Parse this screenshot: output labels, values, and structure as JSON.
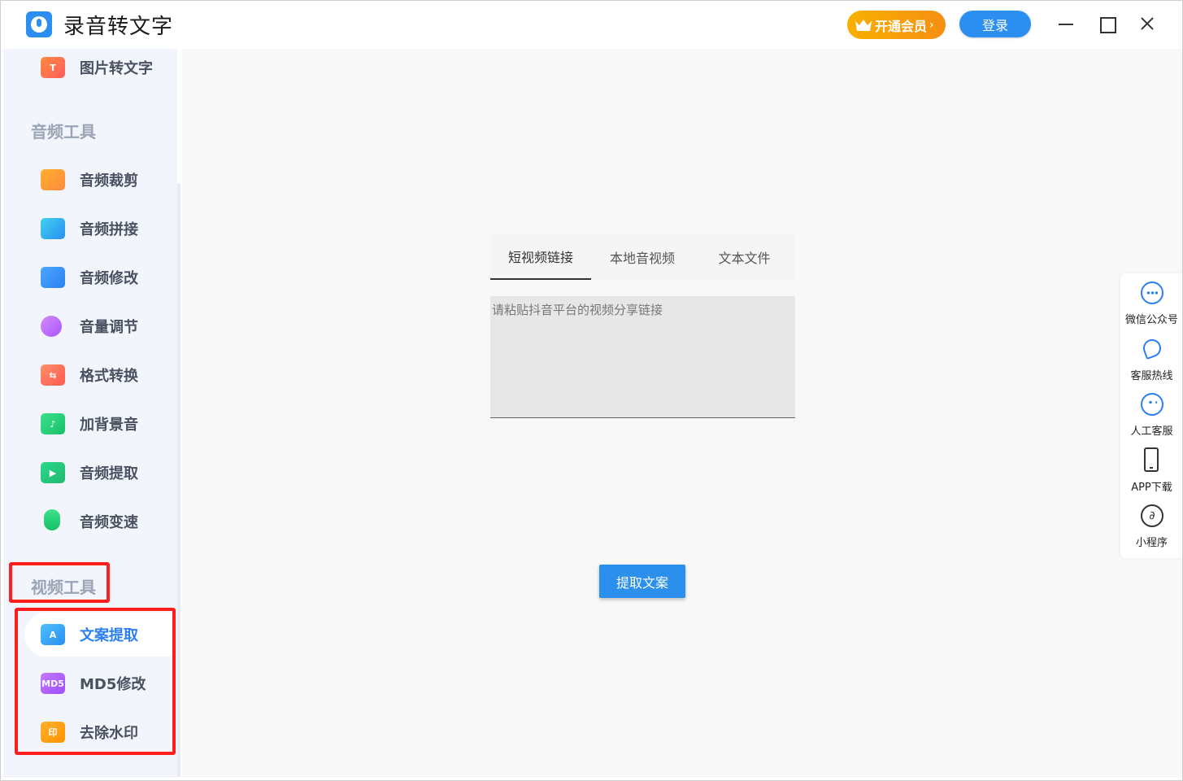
{
  "app": {
    "title": "录音转文字"
  },
  "header": {
    "vip_label": "开通会员",
    "vip_chevron": "›",
    "login_label": "登录"
  },
  "sidebar": {
    "top_item": {
      "label": "图片转文字",
      "icon": "image-to-text-icon"
    },
    "audio_section_title": "音频工具",
    "audio_items": [
      {
        "label": "音频裁剪",
        "icon": "audio-cut-icon"
      },
      {
        "label": "音频拼接",
        "icon": "audio-join-icon"
      },
      {
        "label": "音频修改",
        "icon": "audio-edit-icon"
      },
      {
        "label": "音量调节",
        "icon": "volume-icon"
      },
      {
        "label": "格式转换",
        "icon": "format-convert-icon"
      },
      {
        "label": "加背景音",
        "icon": "background-music-icon"
      },
      {
        "label": "音频提取",
        "icon": "audio-extract-icon"
      },
      {
        "label": "音频变速",
        "icon": "audio-speed-icon"
      }
    ],
    "video_section_title": "视频工具",
    "video_items": [
      {
        "label": "文案提取",
        "icon": "text-extract-icon",
        "active": true
      },
      {
        "label": "MD5修改",
        "icon": "md5-icon",
        "glyph": "MD5"
      },
      {
        "label": "去除水印",
        "icon": "watermark-icon",
        "glyph": "印"
      }
    ]
  },
  "main": {
    "tabs": [
      {
        "label": "短视频链接",
        "active": true
      },
      {
        "label": "本地音视频"
      },
      {
        "label": "文本文件"
      }
    ],
    "input": {
      "placeholder": "请粘贴抖音平台的视频分享链接",
      "value": ""
    },
    "extract_button": "提取文案"
  },
  "side_panel": {
    "items": [
      {
        "label": "微信公众号",
        "icon": "wechat-bubble-icon"
      },
      {
        "label": "客服热线",
        "icon": "phone-icon"
      },
      {
        "label": "人工客服",
        "icon": "customer-service-icon"
      },
      {
        "label": "APP下载",
        "icon": "mobile-icon"
      },
      {
        "label": "小程序",
        "icon": "mini-program-icon"
      }
    ]
  },
  "colors": {
    "accent": "#2b7ff0",
    "vip_gradient": [
      "#f9b000",
      "#f68f12"
    ],
    "highlight": "#ff1e1e"
  }
}
